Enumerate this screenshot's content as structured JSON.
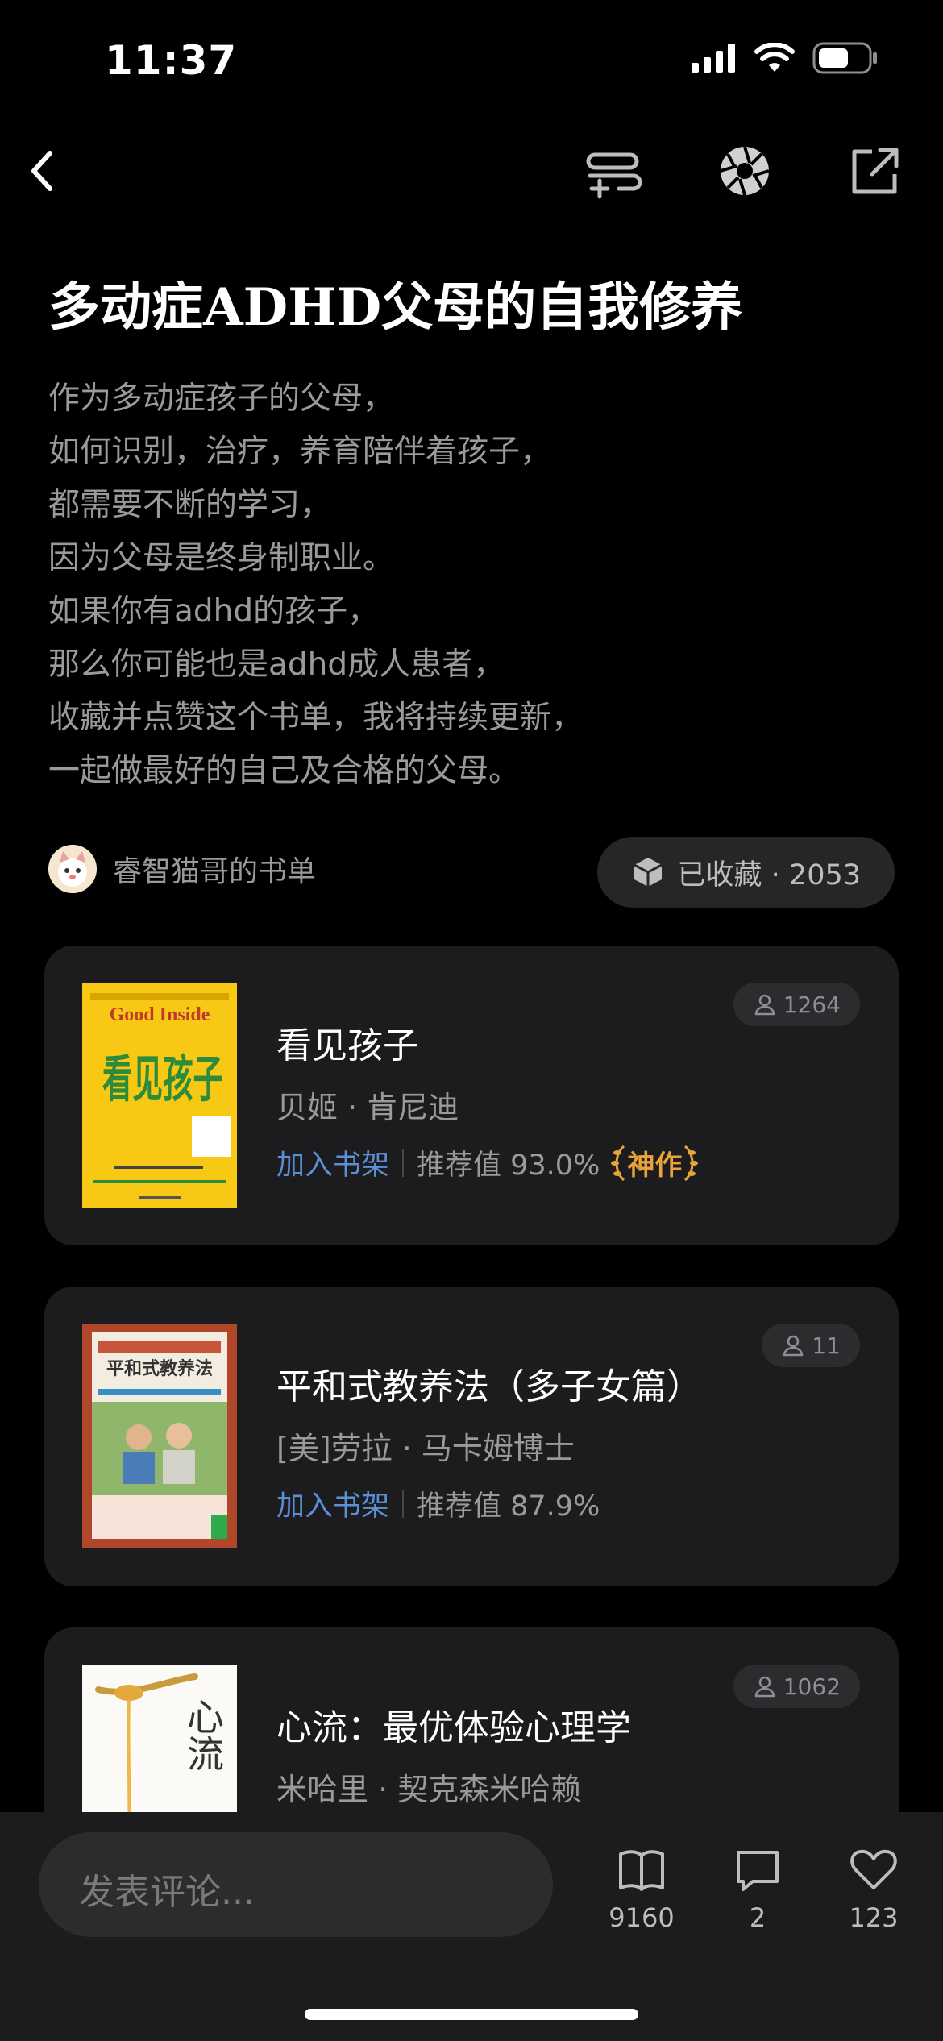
{
  "status_bar": {
    "time": "11:37"
  },
  "page": {
    "title": "多动症ADHD父母的自我修养",
    "description": [
      "作为多动症孩子的父母，",
      "如何识别，治疗，养育陪伴着孩子，",
      "都需要不断的学习，",
      "因为父母是终身制职业。",
      "如果你有adhd的孩子，",
      "那么你可能也是adhd成人患者，",
      "收藏并点赞这个书单，我将持续更新，",
      "一起做最好的自己及合格的父母。"
    ],
    "author": "睿智猫哥的书单",
    "collect_label": "已收藏 · 2053"
  },
  "books": [
    {
      "title": "看见孩子",
      "author": "贝姬 · 肯尼迪",
      "add_label": "加入书架",
      "score": "推荐值 93.0%",
      "badge": "神作",
      "readers": "1264",
      "cover": {
        "top": "Good Inside",
        "title": "看见孩子"
      }
    },
    {
      "title": "平和式教养法（多子女篇）",
      "author": "[美]劳拉 · 马卡姆博士",
      "add_label": "加入书架",
      "score": "推荐值 87.9%",
      "readers": "11",
      "cover": {
        "title": "平和式教养法"
      }
    },
    {
      "title": "心流：最优体验心理学",
      "author": "米哈里 · 契克森米哈赖",
      "readers": "1062",
      "cover": {
        "title": "心流"
      }
    }
  ],
  "bottom_bar": {
    "comment_placeholder": "发表评论...",
    "read_count": "9160",
    "comment_count": "2",
    "like_count": "123"
  },
  "colors": {
    "background": "#000000",
    "card": "#1c1c1e",
    "link": "#5b8fd6",
    "badge": "#e8a33a"
  },
  "icons": [
    "back-icon",
    "add-list-icon",
    "shutter-icon",
    "share-icon",
    "cube-icon",
    "person-icon",
    "book-icon",
    "comment-icon",
    "heart-icon"
  ]
}
